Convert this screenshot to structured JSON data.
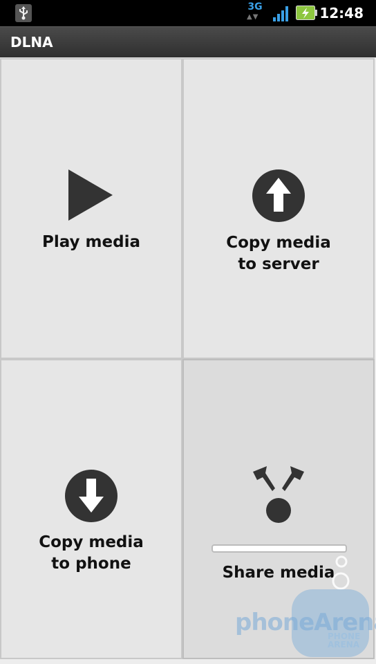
{
  "status_bar": {
    "network_type": "3G",
    "network_arrows": "▲▼",
    "time": "12:48"
  },
  "app": {
    "title": "DLNA"
  },
  "tiles": [
    {
      "label": "Play media",
      "icon": "play-icon"
    },
    {
      "label": "Copy media\nto server",
      "icon": "upload-arrow-icon"
    },
    {
      "label": "Copy media\nto phone",
      "icon": "download-arrow-icon"
    },
    {
      "label": "Share media",
      "icon": "share-icon"
    }
  ],
  "watermark": {
    "brand": "phoneArena",
    "small": "PHONE\nARENA"
  },
  "colors": {
    "icon": "#333333",
    "tile_background": "#e6e6e6",
    "network_type": "#3aa0e6",
    "battery": "#8dc63f"
  }
}
